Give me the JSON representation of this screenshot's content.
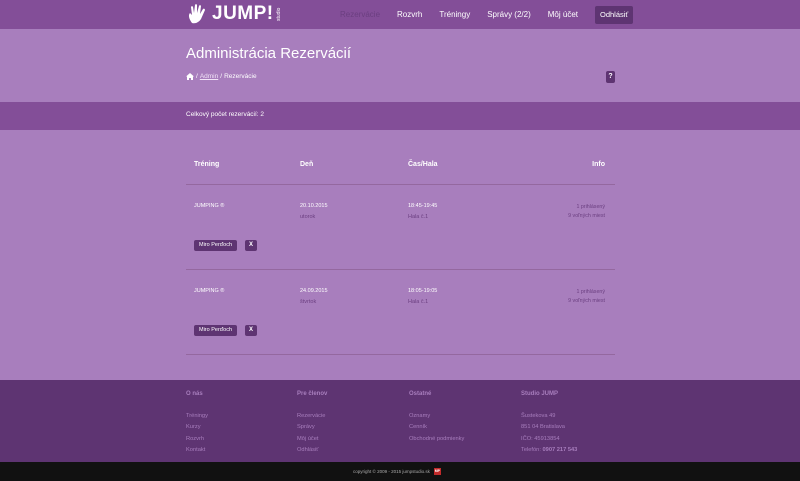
{
  "brand": {
    "name": "JUMP!",
    "sub": "studio"
  },
  "nav": {
    "items": [
      "Rezervácie",
      "Rozvrh",
      "Tréningy",
      "Správy (2/2)",
      "Môj účet"
    ],
    "logout": "Odhlásiť"
  },
  "page": {
    "title": "Administrácia Rezervácií",
    "help": "?"
  },
  "breadcrumb": {
    "sep": "/",
    "admin": "Admin",
    "current": "Rezervácie"
  },
  "summary": "Celkový počet rezervácií: 2",
  "table": {
    "headers": {
      "training": "Tréning",
      "day": "Deň",
      "time": "Čas/Hala",
      "info": "Info"
    },
    "rows": [
      {
        "training": "JUMPING ®",
        "date": "20.10.2015",
        "weekday": "utorok",
        "time": "18:45-19:45",
        "hall": "Hala č.1",
        "info1": "1 prihlásený",
        "info2": "9 voľných miest",
        "person": "Miro Perďoch",
        "delete": "X"
      },
      {
        "training": "JUMPING ®",
        "date": "24.09.2015",
        "weekday": "štvrtok",
        "time": "18:05-19:05",
        "hall": "Hala č.1",
        "info1": "1 prihlásený",
        "info2": "9 voľných miest",
        "person": "Miro Perďoch",
        "delete": "X"
      }
    ]
  },
  "footer": {
    "cols": [
      {
        "title": "O nás",
        "links": [
          "Tréningy",
          "Kurzy",
          "Rozvrh",
          "Kontakt"
        ]
      },
      {
        "title": "Pre členov",
        "links": [
          "Rezervácie",
          "Správy",
          "Môj účet",
          "Odhlásiť"
        ]
      },
      {
        "title": "Ostatné",
        "links": [
          "Oznamy",
          "Cenník",
          "Obchodné podmienky"
        ]
      }
    ],
    "studio": {
      "title": "Studio JUMP",
      "street": "Šustekova 49",
      "city": "851 04 Bratislava",
      "ico": "IČO: 45913854",
      "phone_label": "Telefón:",
      "phone": "0907 217 543"
    }
  },
  "copyright": "copyright © 2009 - 2015 jumpstudio.sk",
  "copyright_badge": "MP"
}
